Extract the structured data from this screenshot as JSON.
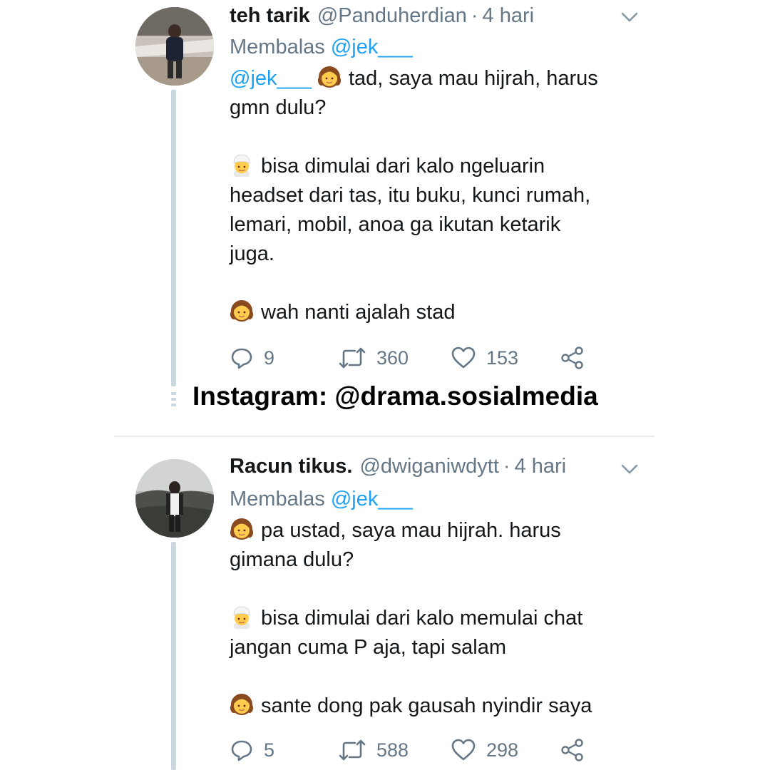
{
  "tweets": [
    {
      "name": "teh tarik",
      "handle": "@Panduherdian",
      "separator": "·",
      "time": "4 hari",
      "reply_label": "Membalas",
      "reply_to": "@jek___",
      "body_lines": [
        {
          "mention": "@jek___",
          "emoji": "girl",
          "text": "tad, saya mau hijrah, harus"
        },
        {
          "text": "gmn dulu?"
        },
        {
          "text": ""
        },
        {
          "emoji": "man-turban",
          "text": "bisa dimulai dari kalo ngeluarin"
        },
        {
          "text": "headset dari tas, itu buku, kunci rumah,"
        },
        {
          "text": "lemari, mobil, anoa ga ikutan ketarik"
        },
        {
          "text": "juga."
        },
        {
          "text": ""
        },
        {
          "emoji": "girl",
          "text": "wah nanti ajalah stad"
        }
      ],
      "replies": "9",
      "retweets": "360",
      "likes": "153"
    },
    {
      "name": "Racun tikus.",
      "handle": "@dwiganiwdytt",
      "separator": "·",
      "time": "4 hari",
      "reply_label": "Membalas",
      "reply_to": "@jek___",
      "body_lines": [
        {
          "emoji": "girl",
          "text": "pa ustad, saya mau hijrah. harus"
        },
        {
          "text": "gimana dulu?"
        },
        {
          "text": ""
        },
        {
          "emoji": "man-turban",
          "text": "bisa dimulai dari kalo memulai chat"
        },
        {
          "text": "jangan cuma P aja, tapi salam"
        },
        {
          "text": ""
        },
        {
          "emoji": "girl",
          "text": "sante dong pak gausah nyindir saya"
        }
      ],
      "replies": "5",
      "retweets": "588",
      "likes": "298"
    }
  ],
  "watermark": "Instagram: @drama.sosialmedia",
  "colors": {
    "link": "#1da1f2",
    "secondary": "#657786",
    "thread_line": "#ccd6dd",
    "divider": "#e6ecf0"
  },
  "icons": [
    "reply-icon",
    "retweet-icon",
    "like-icon",
    "share-icon",
    "caret-down-icon"
  ]
}
